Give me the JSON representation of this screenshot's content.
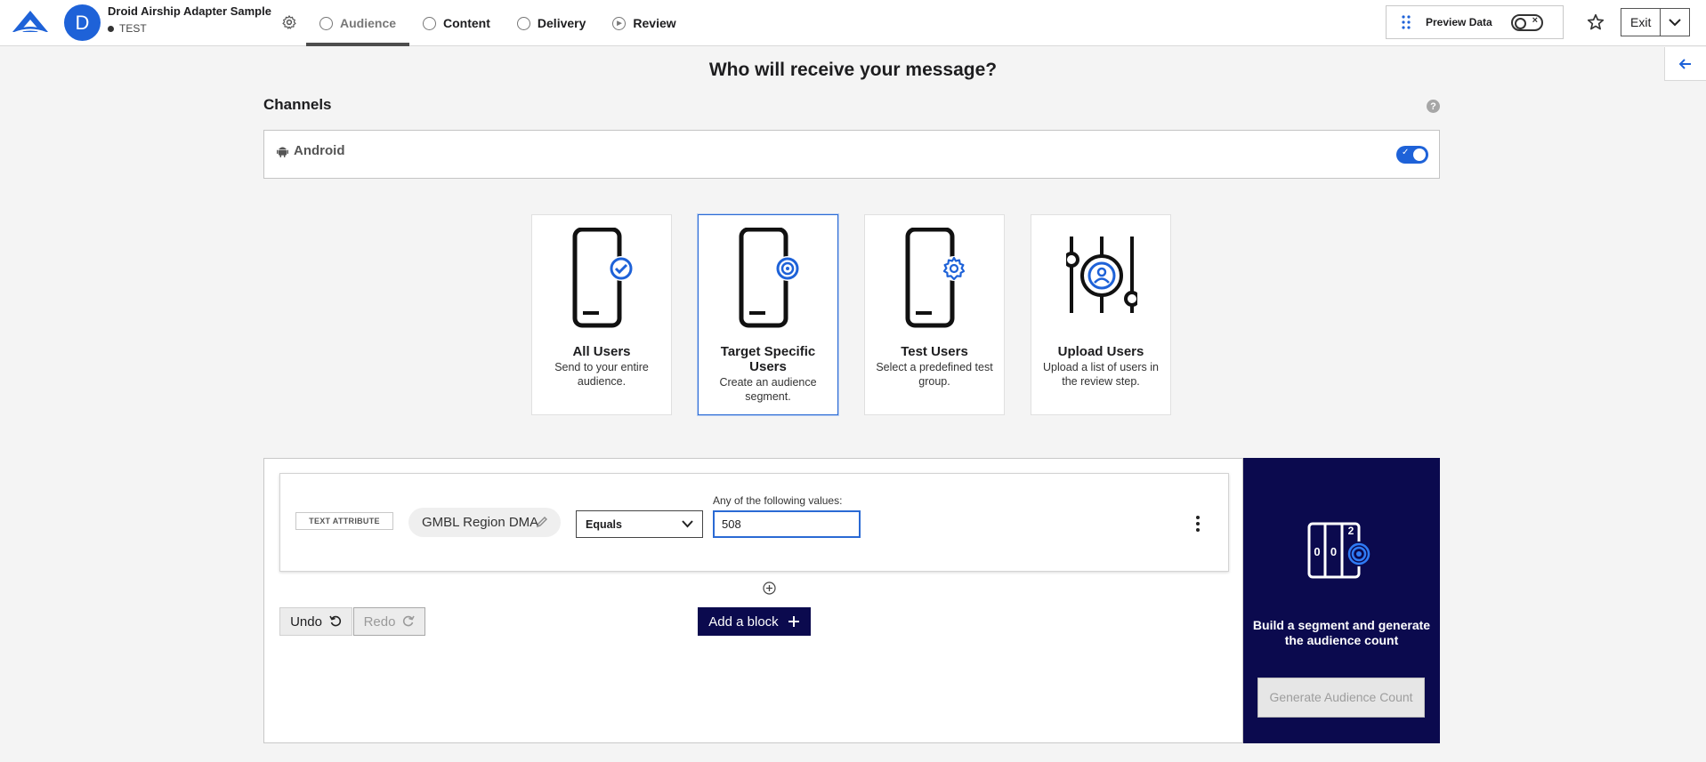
{
  "header": {
    "app_name": "Droid Airship Adapter Sample",
    "avatar_letter": "D",
    "environment": "TEST",
    "steps": [
      {
        "label": "Audience",
        "state": "active"
      },
      {
        "label": "Content",
        "state": "pending"
      },
      {
        "label": "Delivery",
        "state": "pending"
      },
      {
        "label": "Review",
        "state": "pending"
      }
    ],
    "preview_label": "Preview Data",
    "preview_enabled": false,
    "exit_label": "Exit"
  },
  "page": {
    "title": "Who will receive your message?"
  },
  "channels": {
    "heading": "Channels",
    "help_glyph": "?",
    "items": [
      {
        "label": "Android",
        "enabled": true
      }
    ]
  },
  "audience_options": [
    {
      "title": "All Users",
      "description": "Send to your entire audience.",
      "icon": "phone-check-icon",
      "selected": false
    },
    {
      "title": "Target Specific Users",
      "description": "Create an audience segment.",
      "icon": "phone-target-icon",
      "selected": true
    },
    {
      "title": "Test Users",
      "description": "Select a predefined test group.",
      "icon": "phone-gear-icon",
      "selected": false
    },
    {
      "title": "Upload Users",
      "description": "Upload a list of users in the review step.",
      "icon": "user-sliders-icon",
      "selected": false
    }
  ],
  "segment_builder": {
    "rule": {
      "type_tag": "TEXT ATTRIBUTE",
      "attribute": "GMBL Region DMA",
      "operator": "Equals",
      "values_label": "Any of the following values:",
      "value": "508"
    },
    "undo_label": "Undo",
    "redo_label": "Redo",
    "add_block_label": "Add a block"
  },
  "count_panel": {
    "message": "Build a segment and generate the audience count",
    "button_label": "Generate Audience Count",
    "counter_digits": [
      "0",
      "0",
      "2"
    ]
  },
  "colors": {
    "accent_blue": "#1e62d8",
    "navy": "#0b0a4e"
  }
}
